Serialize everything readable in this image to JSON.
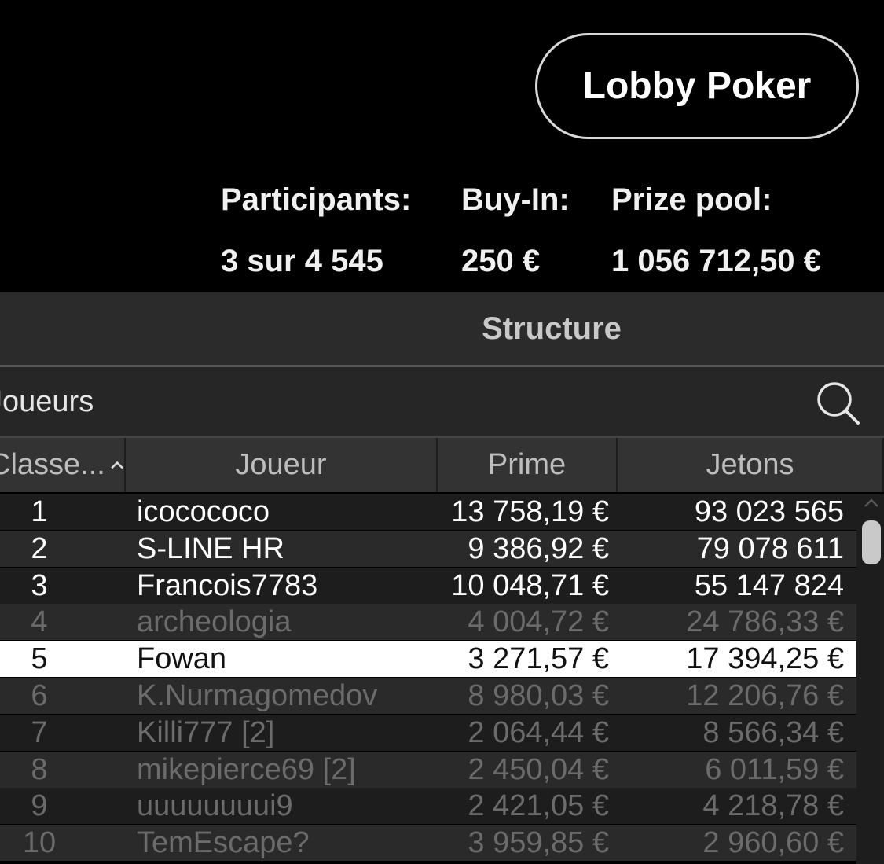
{
  "header": {
    "lobby_button": "Lobby Poker",
    "stats": [
      {
        "label": "Participants:",
        "value": "3 sur 4 545"
      },
      {
        "label": "Buy-In:",
        "value": "250 €"
      },
      {
        "label": "Prize pool:",
        "value": "1 056 712,50 €"
      }
    ]
  },
  "tabs": {
    "structure": "Structure"
  },
  "search": {
    "placeholder": "Joueurs"
  },
  "table": {
    "columns": [
      "Classe...",
      "Joueur",
      "Prime",
      "Jetons"
    ],
    "sort_indicator": "chevron-up-icon",
    "rows": [
      {
        "rank": "1",
        "player": "icocococo",
        "prime": "13 758,19 €",
        "chips": "93 023 565",
        "state": "active"
      },
      {
        "rank": "2",
        "player": "S-LINE HR",
        "prime": "9 386,92 €",
        "chips": "79 078 611",
        "state": "active"
      },
      {
        "rank": "3",
        "player": "Francois7783",
        "prime": "10 048,71 €",
        "chips": "55 147 824",
        "state": "active"
      },
      {
        "rank": "4",
        "player": "archeologia",
        "prime": "4 004,72 €",
        "chips": "24 786,33 €",
        "state": "inactive"
      },
      {
        "rank": "5",
        "player": "Fowan",
        "prime": "3 271,57 €",
        "chips": "17 394,25 €",
        "state": "selected"
      },
      {
        "rank": "6",
        "player": "K.Nurmagomedov",
        "prime": "8 980,03 €",
        "chips": "12 206,76 €",
        "state": "inactive"
      },
      {
        "rank": "7",
        "player": "Killi777 [2]",
        "prime": "2 064,44 €",
        "chips": "8 566,34 €",
        "state": "inactive"
      },
      {
        "rank": "8",
        "player": "mikepierce69 [2]",
        "prime": "2 450,04 €",
        "chips": "6 011,59 €",
        "state": "inactive"
      },
      {
        "rank": "9",
        "player": "uuuuuuuui9",
        "prime": "2 421,05 €",
        "chips": "4 218,78 €",
        "state": "inactive"
      },
      {
        "rank": "10",
        "player": "TemEscape?",
        "prime": "3 959,85 €",
        "chips": "2 960,60 €",
        "state": "inactive"
      }
    ]
  },
  "colors": {
    "background": "#000000",
    "panel": "#2b2b2b",
    "selected_row": "#ffffff",
    "inactive_text": "#6b6b6b"
  }
}
